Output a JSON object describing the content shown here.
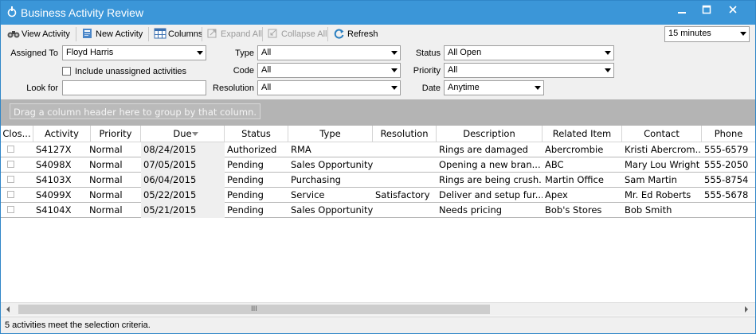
{
  "window": {
    "title": "Business Activity Review",
    "minimize": "▬",
    "maximize": "☐",
    "close": "✕"
  },
  "toolbar": {
    "view_activity": "View Activity",
    "new_activity": "New Activity",
    "columns": "Columns",
    "expand_all": "Expand All",
    "collapse_all": "Collapse All",
    "refresh": "Refresh",
    "refresh_interval": "15 minutes"
  },
  "filters": {
    "assigned_to_label": "Assigned To",
    "assigned_to_value": "Floyd Harris",
    "include_unassigned_label": "Include unassigned activities",
    "look_for_label": "Look for",
    "look_for_value": "",
    "type_label": "Type",
    "type_value": "All",
    "code_label": "Code",
    "code_value": "All",
    "resolution_label": "Resolution",
    "resolution_value": "All",
    "status_label": "Status",
    "status_value": "All Open",
    "priority_label": "Priority",
    "priority_value": "All",
    "date_label": "Date",
    "date_value": "Anytime"
  },
  "group_hint": "Drag a column header here to group by that column.",
  "grid": {
    "columns": [
      "Clos...",
      "Activity",
      "Priority",
      "Due",
      "Status",
      "Type",
      "Resolution",
      "Description",
      "Related Item",
      "Contact",
      "Phone"
    ],
    "rows": [
      [
        "",
        "S4127X",
        "Normal",
        "08/24/2015",
        "Authorized",
        "RMA",
        "",
        "Rings are damaged",
        "Abercrombie",
        "Kristi Abercrom...",
        "555-6579"
      ],
      [
        "",
        "S4098X",
        "Normal",
        "07/05/2015",
        "Pending",
        "Sales Opportunity",
        "",
        "Opening a new bran...",
        "ABC",
        "Mary Lou Wright",
        "555-2050"
      ],
      [
        "",
        "S4103X",
        "Normal",
        "06/04/2015",
        "Pending",
        "Purchasing",
        "",
        "Rings are being crush...",
        "Martin Office",
        "Sam Martin",
        "555-8754"
      ],
      [
        "",
        "S4099X",
        "Normal",
        "05/22/2015",
        "Pending",
        "Service",
        "Satisfactory",
        "Deliver and setup fur...",
        "Apex",
        "Mr. Ed Roberts",
        "555-5678"
      ],
      [
        "",
        "S4104X",
        "Normal",
        "05/21/2015",
        "Pending",
        "Sales Opportunity",
        "",
        "Needs pricing",
        "Bob's Stores",
        "Bob Smith",
        ""
      ]
    ]
  },
  "scrollbar": {
    "grip": "III"
  },
  "status": "5 activities meet the selection criteria."
}
